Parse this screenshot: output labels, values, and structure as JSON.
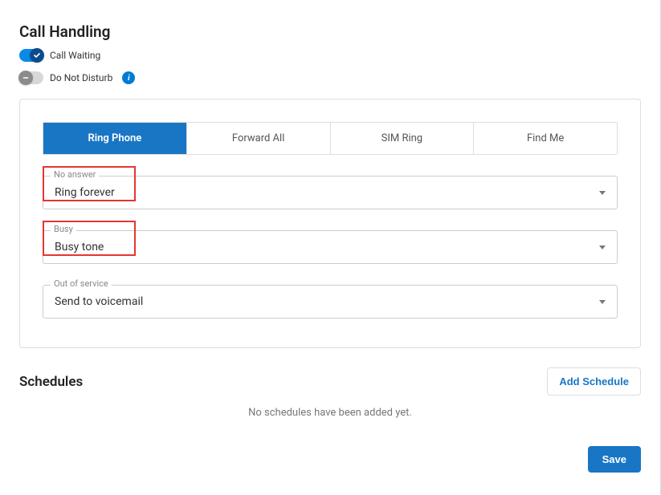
{
  "header": {
    "title": "Call Handling"
  },
  "toggles": {
    "call_waiting": {
      "label": "Call Waiting",
      "state": true
    },
    "dnd": {
      "label": "Do Not Disturb",
      "state": false
    }
  },
  "tabs": [
    {
      "label": "Ring Phone",
      "active": true
    },
    {
      "label": "Forward All",
      "active": false
    },
    {
      "label": "SIM Ring",
      "active": false
    },
    {
      "label": "Find Me",
      "active": false
    }
  ],
  "fields": {
    "no_answer": {
      "label": "No answer",
      "value": "Ring forever",
      "highlighted": true
    },
    "busy": {
      "label": "Busy",
      "value": "Busy tone",
      "highlighted": true
    },
    "out_of_service": {
      "label": "Out of service",
      "value": "Send to voicemail",
      "highlighted": false
    }
  },
  "schedules": {
    "title": "Schedules",
    "add_label": "Add Schedule",
    "empty_text": "No schedules have been added yet."
  },
  "actions": {
    "save_label": "Save"
  },
  "colors": {
    "primary": "#1976c5",
    "toggle_on": "#0a8ae6",
    "highlight": "#e53530"
  }
}
